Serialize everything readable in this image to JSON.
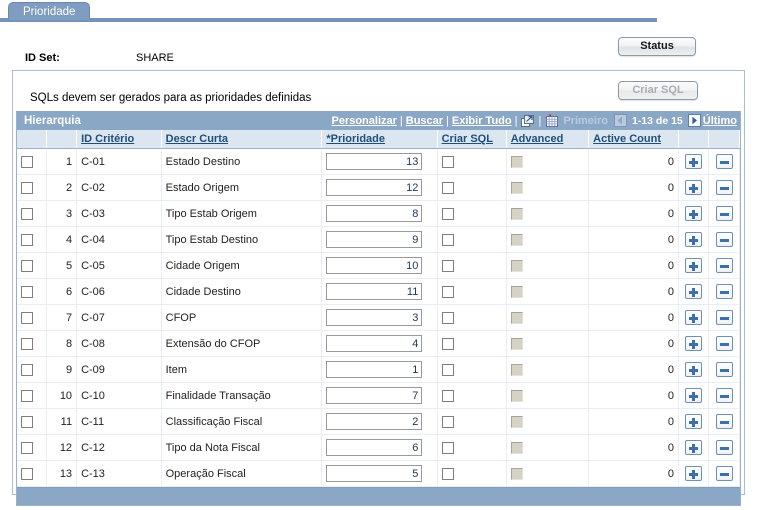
{
  "tab": {
    "label": "Prioridade"
  },
  "header": {
    "id_set_label": "ID Set:",
    "id_set_value": "SHARE",
    "status_button": "Status",
    "criar_sql_button": "Criar SQL"
  },
  "groupbox": {
    "note": "SQLs devem ser gerados para as prioridades definidas"
  },
  "grid": {
    "title": "Hierarquia",
    "nav": {
      "personalizar": "Personalizar",
      "buscar": "Buscar",
      "exibir_tudo": "Exibir Tudo",
      "sep": "|",
      "expand_icon": "expand-icon",
      "spreadsheet_icon": "download-spreadsheet-icon",
      "primeiro": "Primeiro",
      "prev_arrow": "previous-page-arrow",
      "range": "1-13 de 15",
      "next_arrow": "next-page-arrow",
      "ultimo": "Último"
    },
    "columns": {
      "select": "",
      "rownum": "",
      "id_criterio": "ID Critério",
      "descr_curta": "Descr Curta",
      "prioridade": "*Prioridade",
      "criar_sql": "Criar SQL",
      "advanced": "Advanced",
      "active_count": "Active Count"
    },
    "rows": [
      {
        "num": "1",
        "id": "C-01",
        "descr": "Estado Destino",
        "prioridade": "13",
        "criar_sql": false,
        "advanced": false,
        "active_count": "0"
      },
      {
        "num": "2",
        "id": "C-02",
        "descr": "Estado Origem",
        "prioridade": "12",
        "criar_sql": false,
        "advanced": false,
        "active_count": "0"
      },
      {
        "num": "3",
        "id": "C-03",
        "descr": "Tipo Estab Origem",
        "prioridade": "8",
        "criar_sql": false,
        "advanced": false,
        "active_count": "0"
      },
      {
        "num": "4",
        "id": "C-04",
        "descr": "Tipo Estab Destino",
        "prioridade": "9",
        "criar_sql": false,
        "advanced": false,
        "active_count": "0"
      },
      {
        "num": "5",
        "id": "C-05",
        "descr": "Cidade Origem",
        "prioridade": "10",
        "criar_sql": false,
        "advanced": false,
        "active_count": "0"
      },
      {
        "num": "6",
        "id": "C-06",
        "descr": "Cidade Destino",
        "prioridade": "11",
        "criar_sql": false,
        "advanced": false,
        "active_count": "0"
      },
      {
        "num": "7",
        "id": "C-07",
        "descr": "CFOP",
        "prioridade": "3",
        "criar_sql": false,
        "advanced": false,
        "active_count": "0"
      },
      {
        "num": "8",
        "id": "C-08",
        "descr": "Extensão do CFOP",
        "prioridade": "4",
        "criar_sql": false,
        "advanced": false,
        "active_count": "0"
      },
      {
        "num": "9",
        "id": "C-09",
        "descr": "Item",
        "prioridade": "1",
        "criar_sql": false,
        "advanced": false,
        "active_count": "0"
      },
      {
        "num": "10",
        "id": "C-10",
        "descr": "Finalidade Transação",
        "prioridade": "7",
        "criar_sql": false,
        "advanced": false,
        "active_count": "0"
      },
      {
        "num": "11",
        "id": "C-11",
        "descr": "Classificação Fiscal",
        "prioridade": "2",
        "criar_sql": false,
        "advanced": false,
        "active_count": "0"
      },
      {
        "num": "12",
        "id": "C-12",
        "descr": "Tipo da Nota Fiscal",
        "prioridade": "6",
        "criar_sql": false,
        "advanced": false,
        "active_count": "0"
      },
      {
        "num": "13",
        "id": "C-13",
        "descr": "Operação Fiscal",
        "prioridade": "5",
        "criar_sql": false,
        "advanced": false,
        "active_count": "0"
      }
    ],
    "row_add_button": "+",
    "row_delete_button": "-"
  },
  "colors": {
    "tab_blue": "#7e9dc0",
    "grid_header_blue": "#8ba7c6",
    "column_header_bg": "#dce6f1",
    "link_blue": "#1f4e79",
    "value_blue": "#1f3864"
  }
}
